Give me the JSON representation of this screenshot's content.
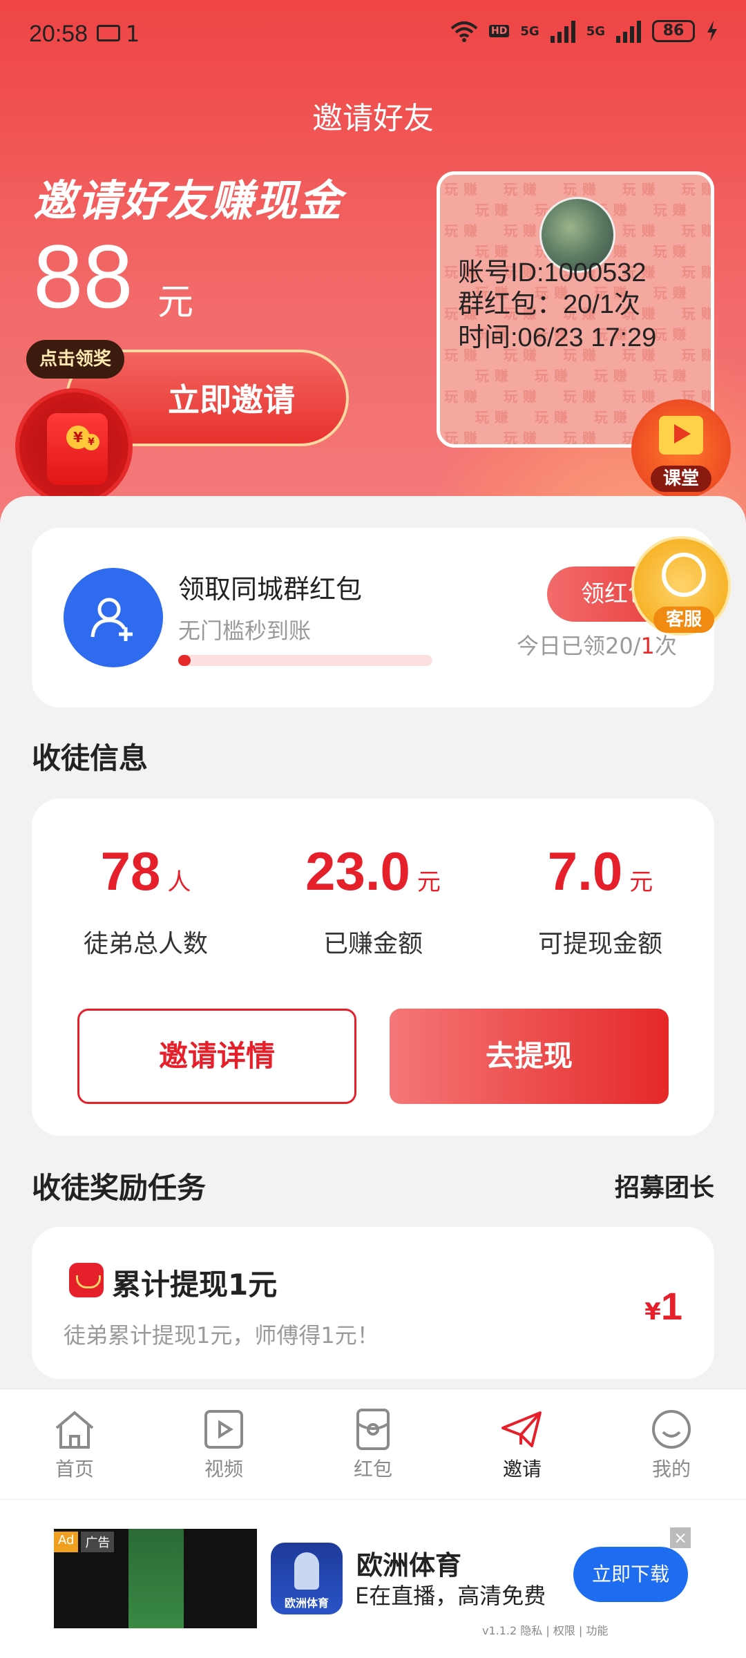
{
  "status_bar": {
    "time": "20:58",
    "msg_count": "1",
    "battery": "86",
    "network_1": "5G",
    "network_2": "5G"
  },
  "header": {
    "title": "邀请好友"
  },
  "hero": {
    "slogan": "邀请好友赚现金",
    "amount": "88",
    "amount_unit": "元",
    "invite_button": "立即邀请",
    "claim_tip": "点击领奖",
    "poster_watermark": "玩赚",
    "poster": {
      "account": "账号ID:1000532",
      "group_redpack": "群红包：20/1次",
      "time": "时间:06/23 17:29"
    },
    "class_badge": "课堂"
  },
  "group_redpack": {
    "title": "领取同城群红包",
    "subtitle": "无门槛秒到账",
    "button": "领红包",
    "count_prefix": "今日已领20/",
    "count_highlight": "1",
    "count_suffix": "次",
    "progress_percent": 5,
    "service_badge": "客服"
  },
  "disciple_section": {
    "title": "收徒信息"
  },
  "stats": [
    {
      "value": "78",
      "unit": "人",
      "label": "徒弟总人数"
    },
    {
      "value": "23.0",
      "unit": "元",
      "label": "已赚金额"
    },
    {
      "value": "7.0",
      "unit": "元",
      "label": "可提现金额"
    }
  ],
  "actions": {
    "invite_detail": "邀请详情",
    "withdraw": "去提现"
  },
  "task_section": {
    "title": "收徒奖励任务",
    "recruit": "招募团长"
  },
  "task": {
    "title": "累计提现1元",
    "subtitle": "徒弟累计提现1元，师傅得1元！",
    "reward_currency": "¥",
    "reward_value": "1"
  },
  "bottom_nav": [
    {
      "label": "首页",
      "icon": "home-icon"
    },
    {
      "label": "视频",
      "icon": "video-icon"
    },
    {
      "label": "红包",
      "icon": "redpacket-icon"
    },
    {
      "label": "邀请",
      "icon": "paper-plane-icon",
      "active": true
    },
    {
      "label": "我的",
      "icon": "smile-icon"
    }
  ],
  "ad": {
    "tag_ad": "Ad",
    "tag_label": "广告",
    "app_name": "欧洲体育",
    "app_icon_caption": "欧洲体育",
    "description": "E在直播，高清免费",
    "download": "立即下载",
    "meta": "v1.1.2  隐私 | 权限 | 功能",
    "colors": {
      "download": "#1e6cf0"
    }
  },
  "colors": {
    "accent": "#e6202a",
    "hero_top": "#ef4444",
    "link_blue": "#2f6bef"
  }
}
